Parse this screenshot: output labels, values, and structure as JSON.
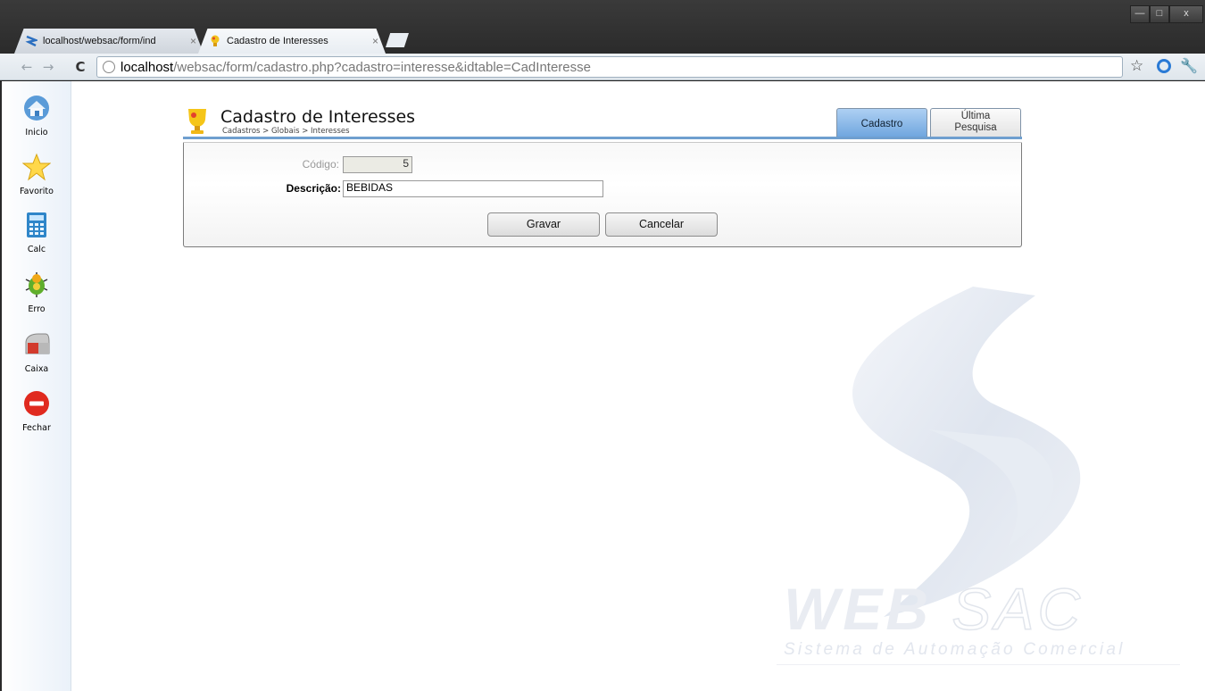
{
  "browser": {
    "tabs": [
      {
        "title": "localhost/websac/form/ind",
        "active": false
      },
      {
        "title": "Cadastro de Interesses",
        "active": true
      }
    ],
    "tab_close_glyph": "×",
    "window_controls": {
      "minimize": "—",
      "maximize": "□",
      "close": "x"
    },
    "url_host": "localhost",
    "url_path": "/websac/form/cadastro.php?cadastro=interesse&idtable=CadInteresse"
  },
  "sidebar": {
    "items": [
      {
        "label": "Inicio",
        "icon": "home-icon"
      },
      {
        "label": "Favorito",
        "icon": "star-icon"
      },
      {
        "label": "Calc",
        "icon": "calculator-icon"
      },
      {
        "label": "Erro",
        "icon": "bug-icon"
      },
      {
        "label": "Caixa",
        "icon": "mailbox-icon"
      },
      {
        "label": "Fechar",
        "icon": "close-icon"
      }
    ]
  },
  "form": {
    "title": "Cadastro de Interesses",
    "breadcrumb": "Cadastros > Globais > Interesses",
    "tabs": {
      "cadastro": "Cadastro",
      "ultima_line1": "Última",
      "ultima_line2": "Pesquisa"
    },
    "fields": {
      "codigo_label": "Código:",
      "codigo_value": "5",
      "descricao_label": "Descrição:",
      "descricao_value": "BEBIDAS"
    },
    "buttons": {
      "save": "Gravar",
      "cancel": "Cancelar"
    }
  },
  "watermark": {
    "brand_web": "WEB",
    "brand_sac": "SAC",
    "tagline": "Sistema de Automação Comercial"
  },
  "colors": {
    "accent": "#6f9fcf",
    "tab_active": "#6ea5de"
  }
}
